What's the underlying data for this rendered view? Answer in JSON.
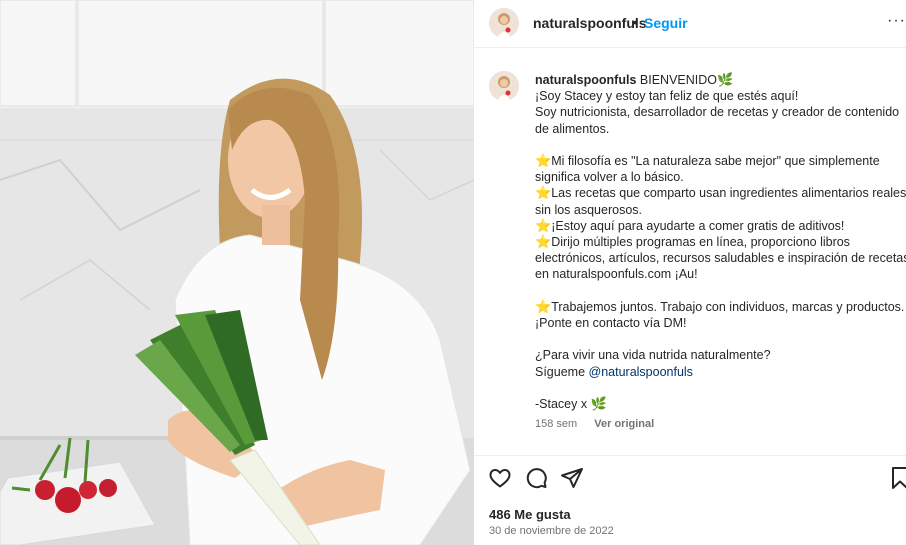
{
  "post": {
    "username": "naturalspoonfuls",
    "separator": "•",
    "follow_label": "Seguir",
    "more_label": "···"
  },
  "caption": {
    "username": "naturalspoonfuls",
    "line1": "BIENVENIDO",
    "line2": "¡Soy Stacey y estoy tan feliz de que estés aquí!",
    "line3": "Soy nutricionista, desarrollador de recetas y creador de contenido",
    "line4": "de alimentos.",
    "line5": "Mi filosofía es \"La naturaleza sabe mejor\" que simplemente",
    "line6": "significa volver a lo básico.",
    "line7": "Las recetas que comparto usan ingredientes alimentarios reales",
    "line8": "sin los asquerosos.",
    "line9": "¡Estoy aquí para ayudarte a comer gratis de aditivos!",
    "line10": "Dirijo múltiples programas en línea, proporciono libros",
    "line11": "electrónicos, artículos, recursos saludables e inspiración de recetas",
    "line12": "en naturalspoonfuls.com ¡Au!",
    "line13": "Trabajemos juntos. Trabajo con individuos, marcas y productos.",
    "line14": "¡Ponte en contacto vía DM!",
    "line15": "¿Para vivir una vida nutrida naturalmente?",
    "line16_prefix": "Sígueme",
    "mention": "@naturalspoonfuls",
    "signoff": "-Stacey x",
    "time_ago": "158 sem",
    "see_original": "Ver original"
  },
  "engagement": {
    "likes": "486 Me gusta",
    "date": "30 de noviembre de 2022"
  },
  "icons": {
    "star": "⭐",
    "leaf": "🌿"
  },
  "colors": {
    "follow_blue": "#0095f6",
    "mention_blue": "#00376b",
    "muted": "#737373",
    "text": "#262626"
  }
}
